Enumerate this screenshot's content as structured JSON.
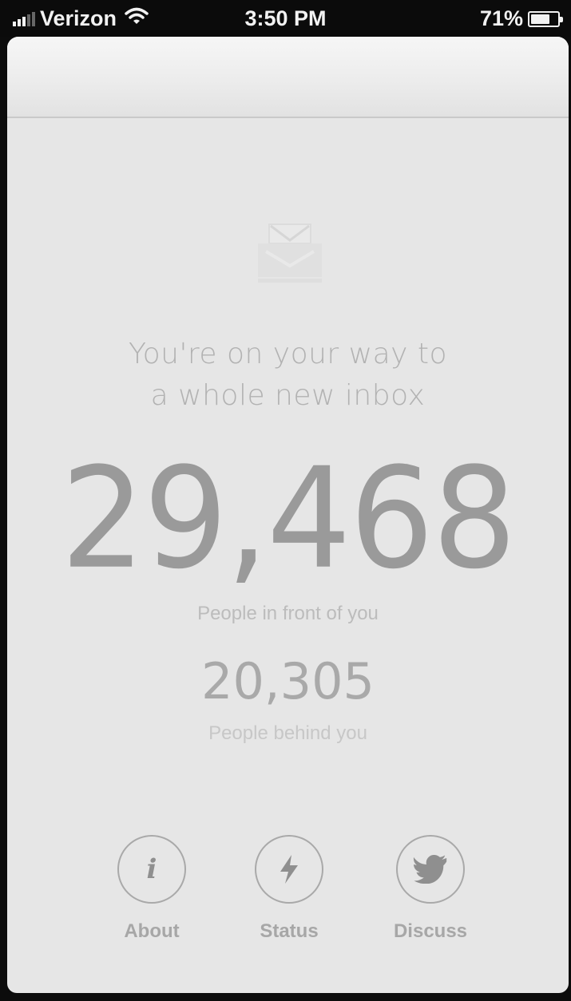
{
  "status_bar": {
    "carrier": "Verizon",
    "time": "3:50 PM",
    "battery": "71%",
    "battery_level": 0.71,
    "icons": [
      "signal-icon",
      "wifi-icon",
      "battery-icon"
    ]
  },
  "main": {
    "icon": "inbox-icon",
    "tagline_line1": "You're on your way to",
    "tagline_line2": "a whole new inbox",
    "ahead_count": "29,468",
    "ahead_label": "People in front of you",
    "behind_count": "20,305",
    "behind_label": "People behind you"
  },
  "nav": {
    "items": [
      {
        "label": "About",
        "icon": "info-icon"
      },
      {
        "label": "Status",
        "icon": "lightning-icon"
      },
      {
        "label": "Discuss",
        "icon": "twitter-bird-icon"
      }
    ]
  },
  "colors": {
    "background": "#e6e6e6",
    "status_bar": "#0b0b0b",
    "text_primary": "#9a9a9a",
    "text_light": "#b2b2b2"
  }
}
